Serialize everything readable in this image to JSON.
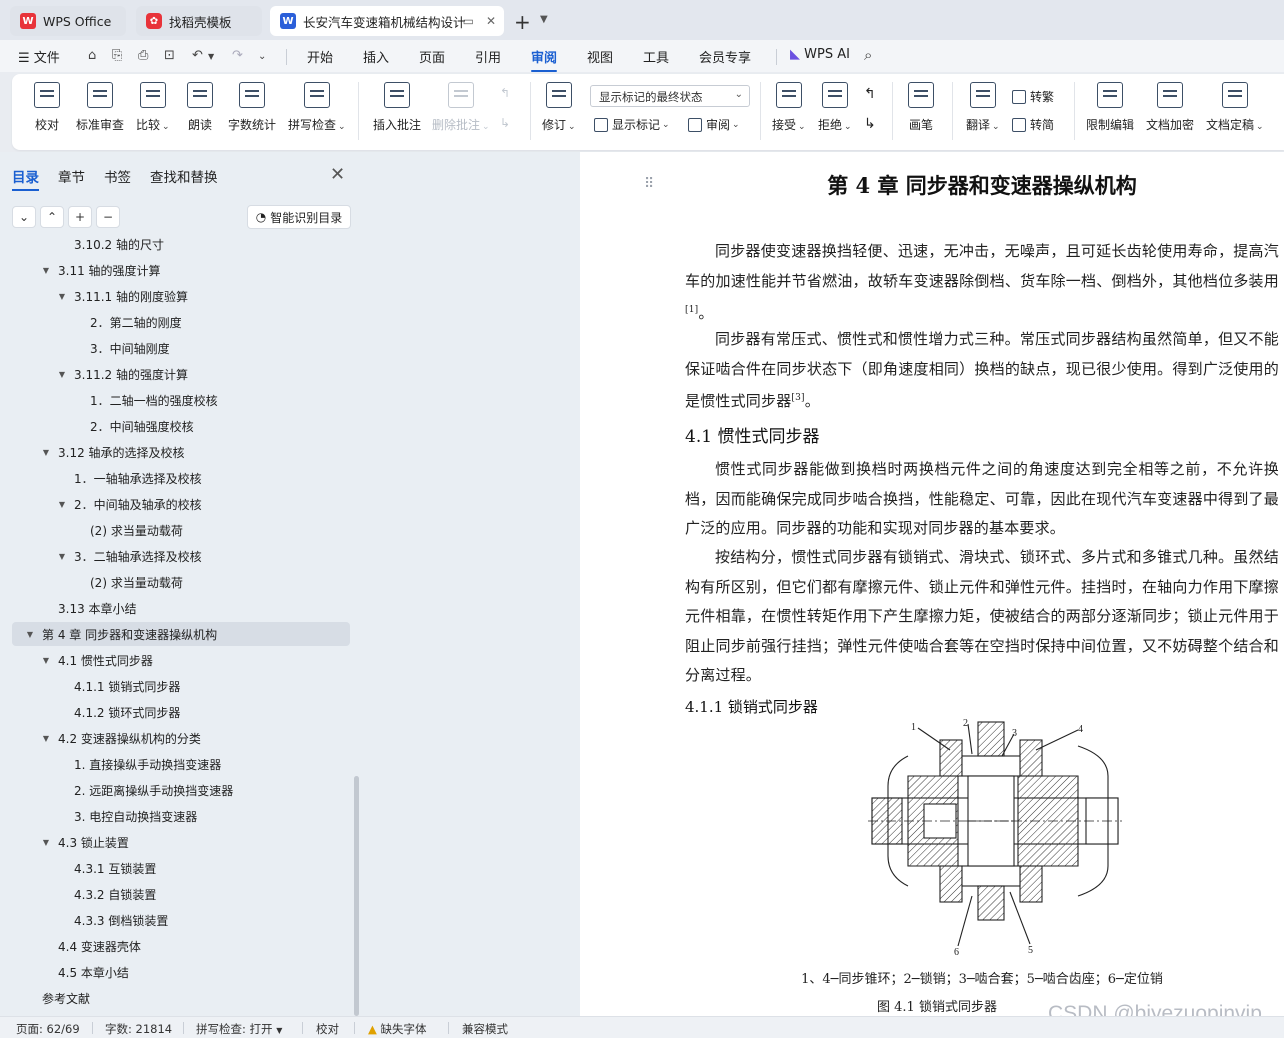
{
  "tabs": [
    {
      "label": "WPS Office",
      "icon": "wps-logo-icon"
    },
    {
      "label": "找稻壳模板",
      "icon": "daoke-icon"
    },
    {
      "label": "长安汽车变速箱机械结构设计",
      "icon": "word-doc-icon"
    }
  ],
  "menu": {
    "file": "文件",
    "items": [
      "开始",
      "插入",
      "页面",
      "引用",
      "审阅",
      "视图",
      "工具",
      "会员专享"
    ],
    "active": "审阅",
    "wps_ai": "WPS AI"
  },
  "ribbon": {
    "proofread": "校对",
    "std_review": "标准审查",
    "compare": "比较",
    "read_aloud": "朗读",
    "word_count": "字数统计",
    "spell_check": "拼写检查",
    "insert_comment": "插入批注",
    "delete_comment": "删除批注",
    "markup_display": "显示标记的最终状态",
    "track_changes": "修订",
    "show_markup": "显示标记",
    "review": "审阅",
    "accept": "接受",
    "reject": "拒绝",
    "pen": "画笔",
    "translate": "翻译",
    "to_traditional": "转繁",
    "to_simplified": "转简",
    "restrict_edit": "限制编辑",
    "encrypt": "文档加密",
    "finalize": "文档定稿"
  },
  "nav": {
    "tabs": [
      "目录",
      "章节",
      "书签",
      "查找和替换"
    ],
    "smart_toc": "智能识别目录",
    "toc": [
      {
        "label": "3.10.2 轴的尺寸",
        "level": 3,
        "toggle": ""
      },
      {
        "label": "3.11 轴的强度计算",
        "level": 2,
        "toggle": "▼"
      },
      {
        "label": "3.11.1 轴的刚度验算",
        "level": 3,
        "toggle": "▼"
      },
      {
        "label": "2．第二轴的刚度",
        "level": 4,
        "toggle": ""
      },
      {
        "label": "3．中间轴刚度",
        "level": 4,
        "toggle": ""
      },
      {
        "label": "3.11.2 轴的强度计算",
        "level": 3,
        "toggle": "▼"
      },
      {
        "label": "1．二轴一档的强度校核",
        "level": 4,
        "toggle": ""
      },
      {
        "label": "2．中间轴强度校核",
        "level": 4,
        "toggle": ""
      },
      {
        "label": "3.12 轴承的选择及校核",
        "level": 2,
        "toggle": "▼"
      },
      {
        "label": "1．一轴轴承选择及校核",
        "level": 3,
        "toggle": ""
      },
      {
        "label": "2．中间轴及轴承的校核",
        "level": 3,
        "toggle": "▼"
      },
      {
        "label": "(2) 求当量动载荷",
        "level": 4,
        "toggle": ""
      },
      {
        "label": "3．二轴轴承选择及校核",
        "level": 3,
        "toggle": "▼"
      },
      {
        "label": "(2) 求当量动载荷",
        "level": 4,
        "toggle": ""
      },
      {
        "label": "3.13 本章小结",
        "level": 2,
        "toggle": ""
      },
      {
        "label": "第 4 章  同步器和变速器操纵机构",
        "level": 1,
        "toggle": "▼",
        "current": true
      },
      {
        "label": "4.1 惯性式同步器",
        "level": 2,
        "toggle": "▼"
      },
      {
        "label": "4.1.1 锁销式同步器",
        "level": 3,
        "toggle": ""
      },
      {
        "label": "4.1.2 锁环式同步器",
        "level": 3,
        "toggle": ""
      },
      {
        "label": "4.2  变速器操纵机构的分类",
        "level": 2,
        "toggle": "▼"
      },
      {
        "label": "1. 直接操纵手动换挡变速器",
        "level": 3,
        "toggle": ""
      },
      {
        "label": "2. 远距离操纵手动换挡变速器",
        "level": 3,
        "toggle": ""
      },
      {
        "label": "3. 电控自动换挡变速器",
        "level": 3,
        "toggle": ""
      },
      {
        "label": "4.3 锁止装置",
        "level": 2,
        "toggle": "▼"
      },
      {
        "label": "4.3.1 互锁装置",
        "level": 3,
        "toggle": ""
      },
      {
        "label": "4.3.2 自锁装置",
        "level": 3,
        "toggle": ""
      },
      {
        "label": "4.3.3 倒档锁装置",
        "level": 3,
        "toggle": ""
      },
      {
        "label": "4.4 变速器壳体",
        "level": 2,
        "toggle": ""
      },
      {
        "label": "4.5 本章小结",
        "level": 2,
        "toggle": ""
      },
      {
        "label": "参考文献",
        "level": 1,
        "toggle": ""
      }
    ]
  },
  "document": {
    "chapter_title": "第 4 章  同步器和变速器操纵机构",
    "p1": "同步器使变速器换挡轻便、迅速，无冲击，无噪声，且可延长齿轮使用寿命，提高汽车的加速性能并节省燃油，故轿车变速器除倒档、货车除一档、倒档外，其他档位多装用",
    "p1_ref": "[1]",
    "p1_end": "。",
    "p2": "同步器有常压式、惯性式和惯性增力式三种。常压式同步器结构虽然简单，但又不能保证啮合件在同步状态下（即角速度相同）换档的缺点，现已很少使用。得到广泛使用的是惯性式同步器",
    "p2_ref": "[3]",
    "p2_end": "。",
    "sec_4_1": "4.1 惯性式同步器",
    "p3": "惯性式同步器能做到换档时两换档元件之间的角速度达到完全相等之前，不允许换档，因而能确保完成同步啮合换挡，性能稳定、可靠，因此在现代汽车变速器中得到了最广泛的应用。同步器的功能和实现对同步器的基本要求。",
    "p4": "按结构分，惯性式同步器有锁销式、滑块式、锁环式、多片式和多锥式几种。虽然结构有所区别，但它们都有摩擦元件、锁止元件和弹性元件。挂挡时，在轴向力作用下摩擦元件相靠，在惯性转矩作用下产生摩擦力矩，使被结合的两部分逐渐同步；锁止元件用于阻止同步前强行挂挡；弹性元件使啮合套等在空挡时保持中间位置，又不妨碍整个结合和分离过程。",
    "sec_4_1_1": "4.1.1 锁销式同步器",
    "figure_labels": [
      "1",
      "2",
      "3",
      "4",
      "5",
      "6"
    ],
    "figure_parts": "1、4─同步锥环；2─锁销；3─啮合套；5─啮合齿座；6─定位销",
    "figure_caption": "图 4.1  锁销式同步器"
  },
  "watermark": "CSDN @biyezuopinvip",
  "status": {
    "page": "页面: 62/69",
    "words": "字数: 21814",
    "spell": "拼写检查: 打开",
    "proofread": "校对",
    "missing_font": "缺失字体",
    "compat": "兼容模式"
  },
  "colors": {
    "accent": "#1a5fd1",
    "wps_red": "#e8333a"
  }
}
